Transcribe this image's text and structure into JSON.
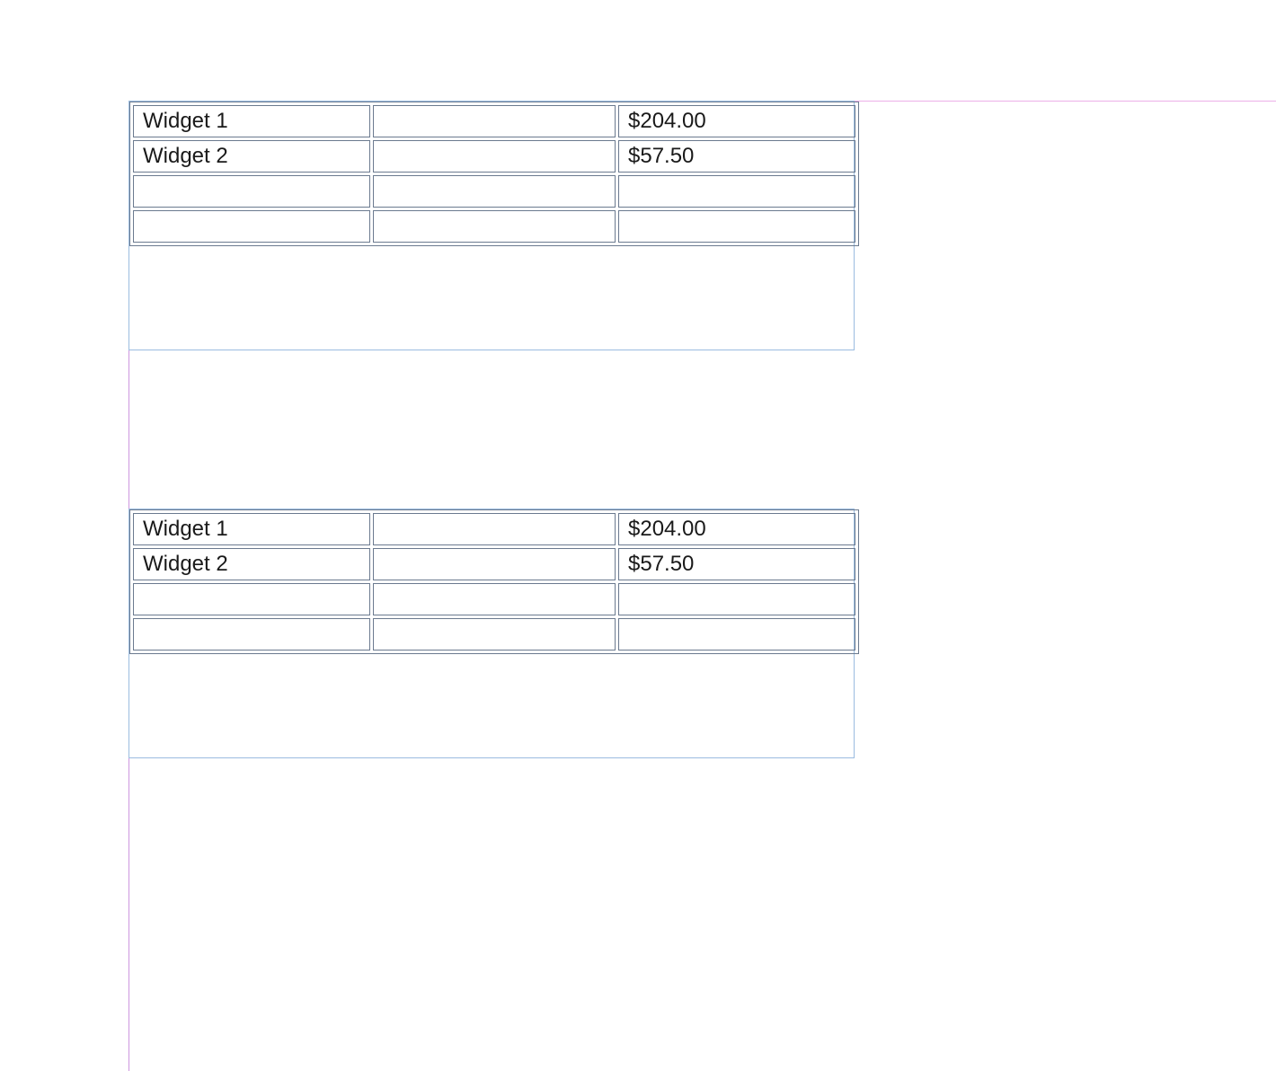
{
  "tables": [
    {
      "rows": [
        {
          "name": "Widget 1",
          "mid": "",
          "price": "$204.00"
        },
        {
          "name": "Widget 2",
          "mid": "",
          "price": "$57.50"
        },
        {
          "name": "",
          "mid": "",
          "price": ""
        },
        {
          "name": "",
          "mid": "",
          "price": ""
        }
      ]
    },
    {
      "rows": [
        {
          "name": "Widget 1",
          "mid": "",
          "price": "$204.00"
        },
        {
          "name": "Widget 2",
          "mid": "",
          "price": "$57.50"
        },
        {
          "name": "",
          "mid": "",
          "price": ""
        },
        {
          "name": "",
          "mid": "",
          "price": ""
        }
      ]
    }
  ]
}
